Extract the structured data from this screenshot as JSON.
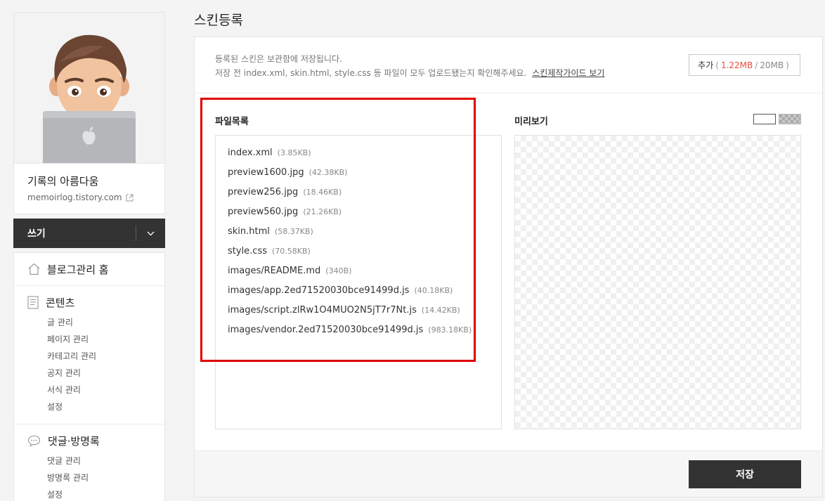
{
  "sidebar": {
    "blog_title": "기록의 아름다움",
    "blog_url": "memoirlog.tistory.com",
    "write_label": "쓰기",
    "home_label": "블로그관리 홈",
    "content_label": "콘텐츠",
    "content_items": [
      "글 관리",
      "페이지 관리",
      "카테고리 관리",
      "공지 관리",
      "서식 관리",
      "설정"
    ],
    "comments_label": "댓글·방명록",
    "comments_items": [
      "댓글 관리",
      "방명록 관리",
      "설정"
    ]
  },
  "main": {
    "title": "스킨등록",
    "notice_line1": "등록된 스킨은 보관함에 저장됩니다.",
    "notice_line2": "저장 전 index.xml, skin.html, style.css 등 파일이 모두 업로드됐는지 확인해주세요.",
    "guide_link": "스킨제작가이드 보기",
    "add_button": {
      "label": "추가",
      "open_paren": "(",
      "used": "1.22MB",
      "separator": "/",
      "total": "20MB",
      "close_paren": ")"
    },
    "file_list_label": "파일목록",
    "preview_label": "미리보기",
    "files": [
      {
        "name": "index.xml",
        "size": "(3.85KB)"
      },
      {
        "name": "preview1600.jpg",
        "size": "(42.38KB)"
      },
      {
        "name": "preview256.jpg",
        "size": "(18.46KB)"
      },
      {
        "name": "preview560.jpg",
        "size": "(21.26KB)"
      },
      {
        "name": "skin.html",
        "size": "(58.37KB)"
      },
      {
        "name": "style.css",
        "size": "(70.58KB)"
      },
      {
        "name": "images/README.md",
        "size": "(340B)"
      },
      {
        "name": "images/app.2ed71520030bce91499d.js",
        "size": "(40.18KB)"
      },
      {
        "name": "images/script.zlRw1O4MUO2N5jT7r7Nt.js",
        "size": "(14.42KB)"
      },
      {
        "name": "images/vendor.2ed71520030bce91499d.js",
        "size": "(983.18KB)"
      }
    ],
    "save_label": "저장"
  },
  "colors": {
    "accent_red": "#f04b3b",
    "dark": "#333333",
    "highlight": "#e00000"
  }
}
